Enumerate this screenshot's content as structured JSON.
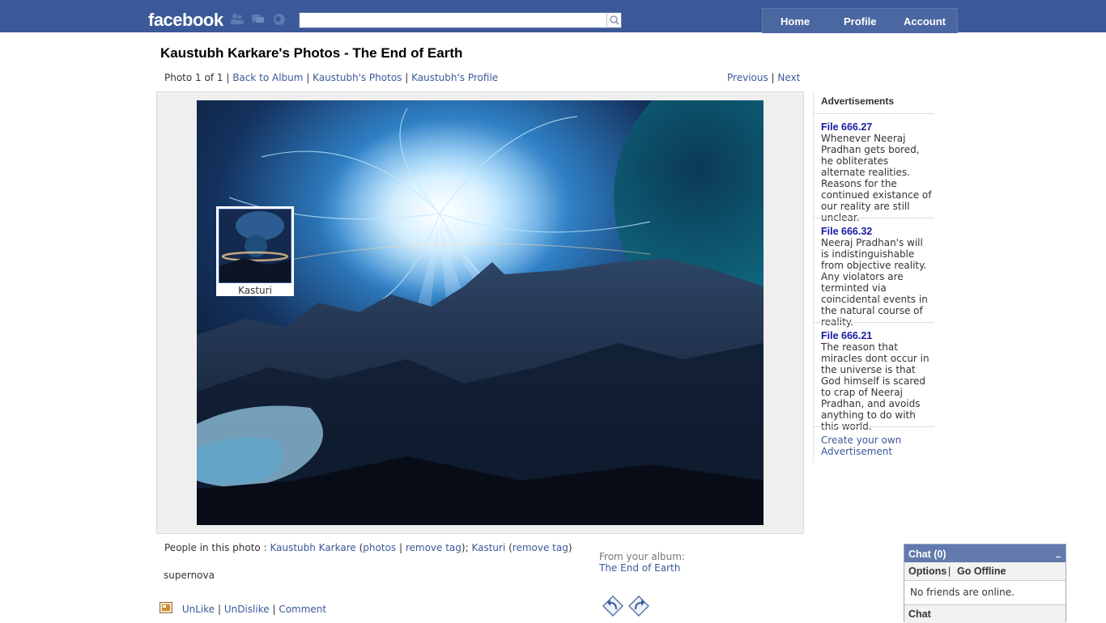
{
  "topbar": {
    "logo": "facebook",
    "nav": {
      "home": "Home",
      "profile": "Profile",
      "account": "Account"
    },
    "icons": [
      "friend-requests-icon",
      "messages-icon",
      "notifications-icon",
      "search-icon"
    ],
    "colors": {
      "bar": "#3b5998",
      "nav": "#4b67a1"
    }
  },
  "page": {
    "title": "Kaustubh Karkare's Photos - The End of Earth",
    "photo_counter": "Photo 1 of 1",
    "links": {
      "back_to_album": "Back to Album",
      "owner_photos": "Kaustubh's Photos",
      "owner_profile": "Kaustubh's Profile",
      "previous": "Previous",
      "next": "Next"
    }
  },
  "photo": {
    "tag": {
      "name": "Kasturi"
    }
  },
  "people": {
    "label": "People in this photo :",
    "person1": "Kaustubh Karkare",
    "person1_photos": "photos",
    "person1_remove": "remove tag",
    "person2": "Kasturi",
    "person2_remove": "remove tag"
  },
  "caption": "supernova",
  "actions": {
    "unlike": "UnLike",
    "undislike": "UnDislike",
    "comment": "Comment"
  },
  "album": {
    "from_label": "From your album:",
    "name": "The End of Earth"
  },
  "ads": {
    "title": "Advertisements",
    "items": [
      {
        "title": "File 666.27",
        "body": "Whenever Neeraj Pradhan gets bored, he obliterates alternate realities. Reasons for the continued existance of our reality are still unclear."
      },
      {
        "title": "File 666.32",
        "body": "Neeraj Pradhan's will is indistinguishable from objective reality. Any violators are terminted via coincidental events in the natural course of reality."
      },
      {
        "title": "File 666.21",
        "body": "The reason that miracles dont occur in the universe is that God himself is scared to crap of Neeraj Pradhan, and avoids anything to do with this world."
      }
    ],
    "create_link": "Create your own Advertisement"
  },
  "chat": {
    "title": "Chat (0)",
    "minimize": "_",
    "options": "Options",
    "go_offline": "Go Offline",
    "status": "No friends are online.",
    "bar_label": "Chat"
  }
}
